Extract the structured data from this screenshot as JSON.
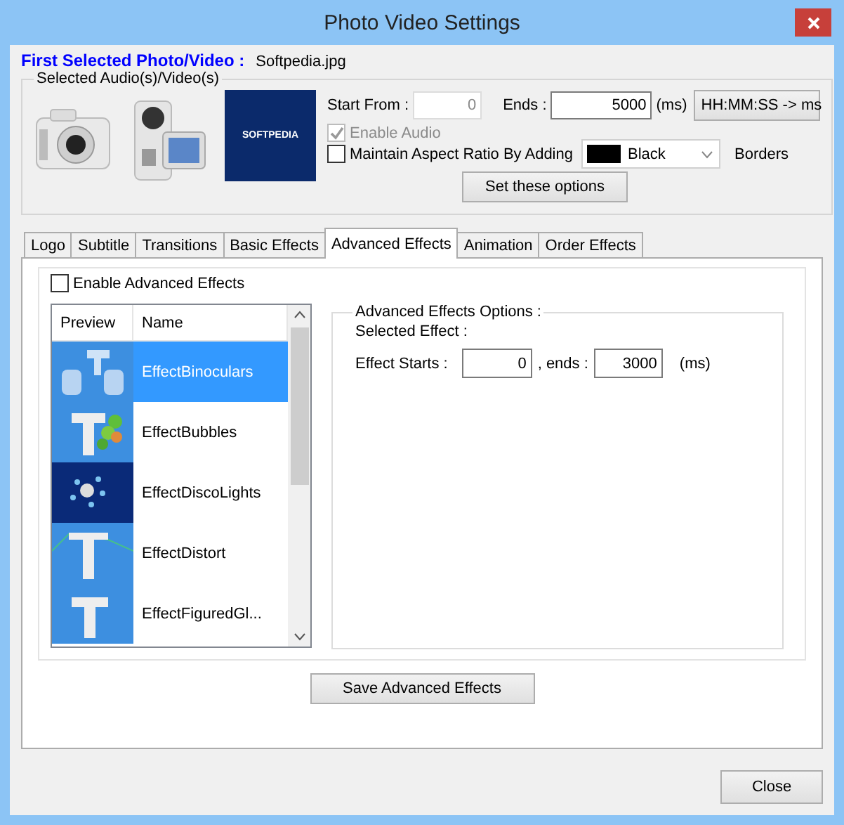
{
  "window": {
    "title": "Photo Video Settings"
  },
  "first_selected": {
    "label": "First Selected Photo/Video :",
    "value": "Softpedia.jpg"
  },
  "media_group": {
    "title": "Selected Audio(s)/Video(s)",
    "thumbnail_text": "SOFTPEDIA",
    "start_from": {
      "label": "Start From :",
      "value": "0",
      "disabled": true
    },
    "ends": {
      "label": "Ends :",
      "value": "5000",
      "unit": "(ms)"
    },
    "convert_button": "HH:MM:SS -> ms",
    "enable_audio": {
      "label": "Enable Audio",
      "checked": true,
      "disabled": true
    },
    "maintain_aspect": {
      "label": "Maintain Aspect Ratio By Adding",
      "checked": false,
      "disabled": false
    },
    "border_color": "Black",
    "borders_label": "Borders",
    "set_button": "Set these options"
  },
  "tabs": [
    {
      "label": "Logo",
      "selected": false
    },
    {
      "label": "Subtitle",
      "selected": false
    },
    {
      "label": "Transitions",
      "selected": false
    },
    {
      "label": "Basic Effects",
      "selected": false
    },
    {
      "label": "Advanced Effects",
      "selected": true
    },
    {
      "label": "Animation",
      "selected": false
    },
    {
      "label": "Order Effects",
      "selected": false
    }
  ],
  "advanced": {
    "enable": {
      "label": "Enable Advanced Effects",
      "checked": false
    },
    "columns": [
      "Preview",
      "Name"
    ],
    "rows": [
      {
        "name": "EffectBinoculars",
        "selected": true
      },
      {
        "name": "EffectBubbles",
        "selected": false
      },
      {
        "name": "EffectDiscoLights",
        "selected": false
      },
      {
        "name": "EffectDistort",
        "selected": false
      },
      {
        "name": "EffectFiguredGl...",
        "selected": false
      }
    ],
    "options": {
      "title": "Advanced Effects Options :",
      "selected_effect": "Selected Effect :",
      "starts_label": "Effect Starts :",
      "starts_value": "0",
      "ends_label": ", ends :",
      "ends_value": "3000",
      "unit": "(ms)"
    },
    "save_button": "Save Advanced Effects"
  },
  "close_button": "Close"
}
